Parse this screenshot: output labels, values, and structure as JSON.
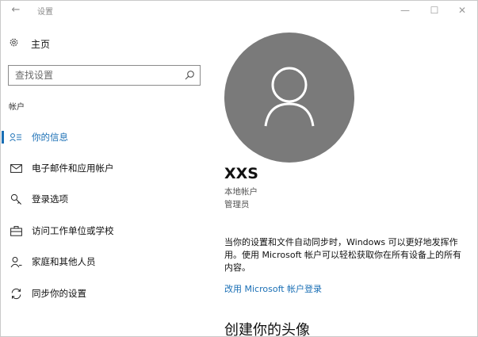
{
  "window": {
    "title": "设置",
    "back_glyph": "←",
    "minimize_glyph": "—",
    "maximize_glyph": "☐",
    "close_glyph": "✕"
  },
  "sidebar": {
    "home_label": "主页",
    "search_placeholder": "查找设置",
    "section_label": "帐户",
    "items": [
      {
        "label": "你的信息",
        "icon": "person-card-icon",
        "active": true
      },
      {
        "label": "电子邮件和应用帐户",
        "icon": "mail-icon",
        "active": false
      },
      {
        "label": "登录选项",
        "icon": "key-icon",
        "active": false
      },
      {
        "label": "访问工作单位或学校",
        "icon": "briefcase-icon",
        "active": false
      },
      {
        "label": "家庭和其他人员",
        "icon": "person-add-icon",
        "active": false
      },
      {
        "label": "同步你的设置",
        "icon": "sync-icon",
        "active": false
      }
    ]
  },
  "main": {
    "username": "XXS",
    "account_type": "本地帐户",
    "account_role": "管理员",
    "sync_text": "当你的设置和文件自动同步时，Windows 可以更好地发挥作用。使用 Microsoft 帐户可以轻松获取你在所有设备上的所有内容。",
    "switch_link": "改用 Microsoft 帐户登录",
    "avatar_heading": "创建你的头像"
  },
  "colors": {
    "accent": "#1a6fb5",
    "avatar_bg": "#7a7a7a"
  }
}
